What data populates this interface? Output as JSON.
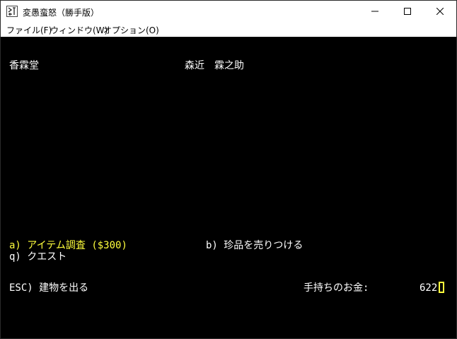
{
  "window": {
    "title": "変愚蛮怒（勝手版）",
    "icon": "app-icon"
  },
  "menu": {
    "file": "ファイル(F)",
    "window": "ウィンドウ(W)",
    "option": "オプション(O)"
  },
  "terminal": {
    "shop_name": "香霖堂",
    "owner_name": "森近　霖之助",
    "option_a": "a) アイテム調査 ($300)",
    "option_b": "b) 珍品を売りつける",
    "option_q": "q) クエスト",
    "option_esc": "ESC) 建物を出る",
    "money_label": "手持ちのお金:",
    "money_value": "622",
    "colors": {
      "background": "#000000",
      "text": "#ffffff",
      "highlight": "#ffff3c"
    }
  }
}
